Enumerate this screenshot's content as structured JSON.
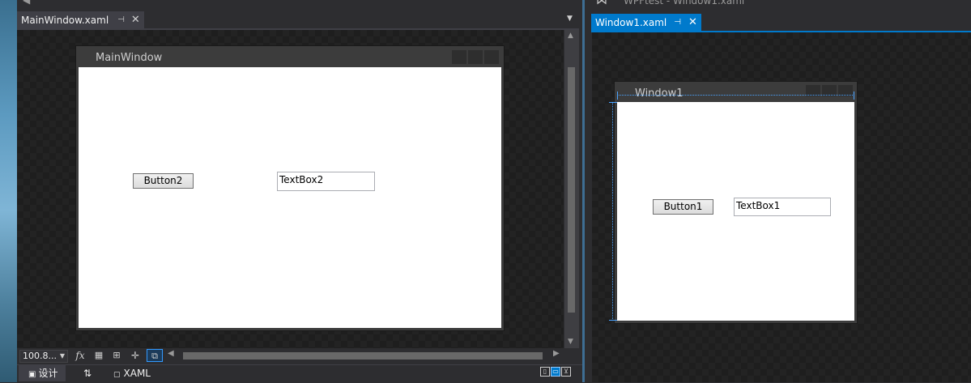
{
  "ide": {
    "window_title": "WPFtest - Window1.xaml"
  },
  "left_pane": {
    "tab": {
      "label": "MainWindow.xaml",
      "pin_icon": "pin-icon",
      "close_icon": "close-icon"
    },
    "designer": {
      "window_title": "MainWindow",
      "button_text": "Button2",
      "textbox_text": "TextBox2"
    },
    "toolbar": {
      "zoom_value": "100.8...",
      "fx_label": "fx",
      "icons": [
        "fx-icon",
        "grid-icon",
        "snap-grid-icon",
        "snap-lines-icon",
        "artboard-icon"
      ]
    },
    "view_tabs": {
      "design_label": "设计",
      "swap_label": "⇅",
      "xaml_label": "XAML"
    }
  },
  "right_pane": {
    "tab": {
      "label": "Window1.xaml",
      "pin_icon": "pin-icon",
      "close_icon": "close-icon"
    },
    "designer": {
      "window_title": "Window1",
      "button_text": "Button1",
      "textbox_text": "TextBox1"
    }
  },
  "colors": {
    "ide_background": "#2d2d30",
    "designer_background": "#1e1e1e",
    "active_tab": "#007acc",
    "inactive_tab": "#3f3f46",
    "mock_window_frame": "#3c3c3c",
    "mock_window_client": "#ffffff"
  }
}
